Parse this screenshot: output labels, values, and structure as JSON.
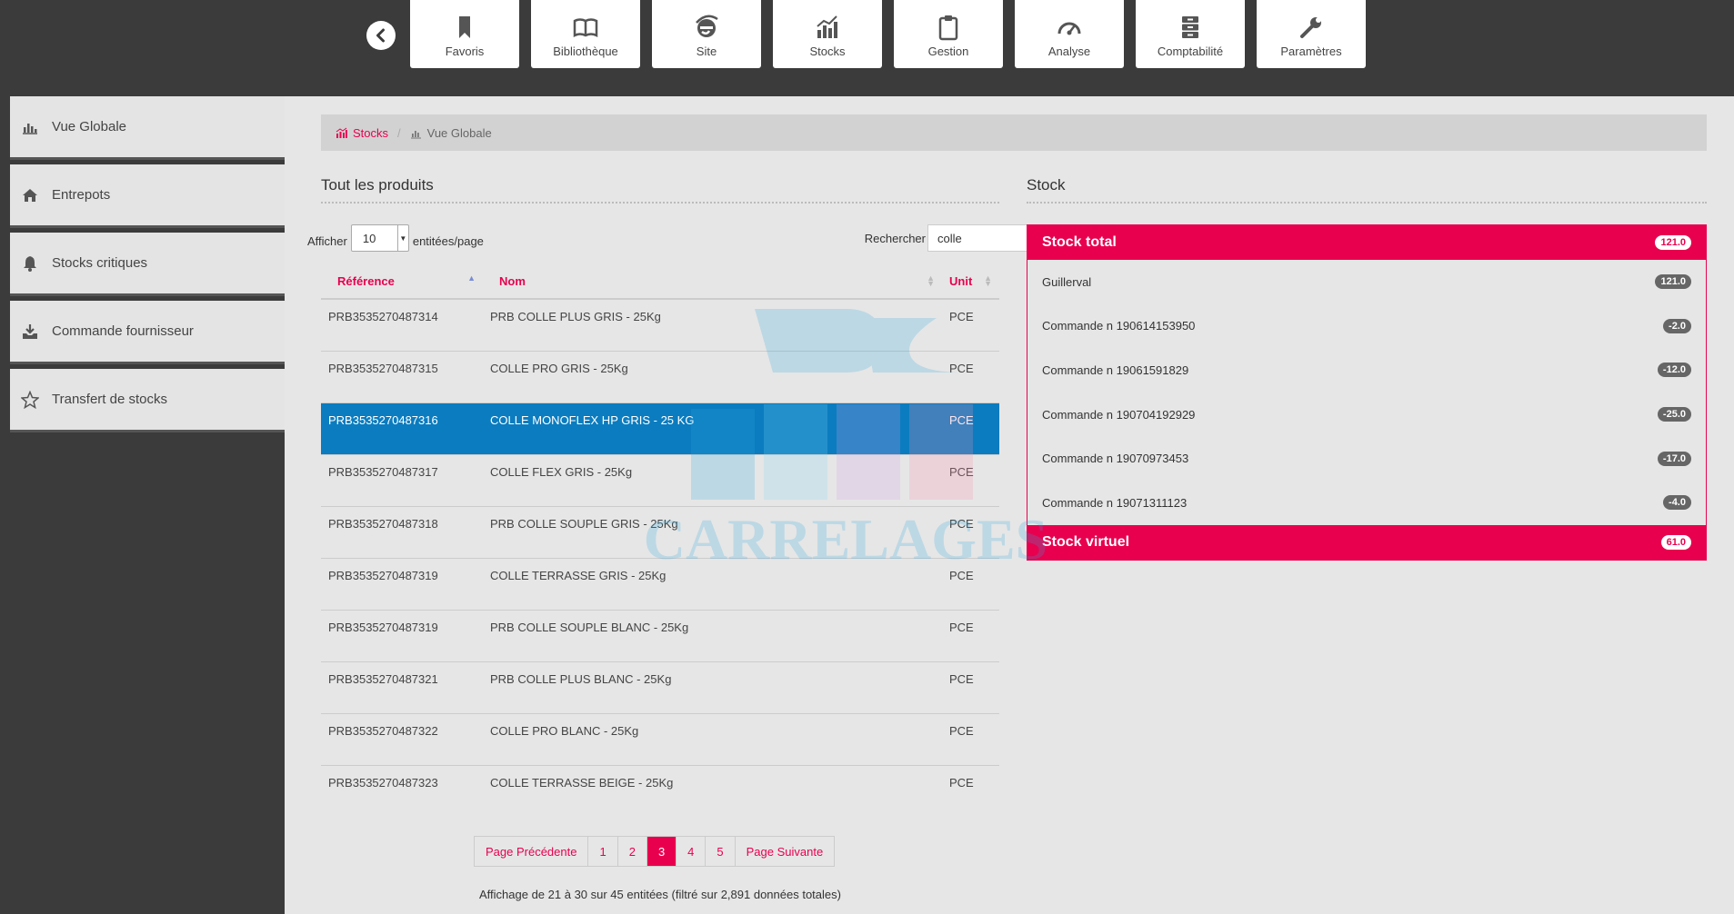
{
  "toolbar": {
    "tiles": [
      {
        "label": "Favoris",
        "icon": "bookmark-icon"
      },
      {
        "label": "Bibliothèque",
        "icon": "book-icon"
      },
      {
        "label": "Site",
        "icon": "internet-explorer-icon"
      },
      {
        "label": "Stocks",
        "icon": "chart-icon"
      },
      {
        "label": "Gestion",
        "icon": "clipboard-icon"
      },
      {
        "label": "Analyse",
        "icon": "gauge-icon"
      },
      {
        "label": "Comptabilité",
        "icon": "archive-icon"
      },
      {
        "label": "Paramètres",
        "icon": "wrench-icon"
      }
    ]
  },
  "sidebar": {
    "items": [
      {
        "label": "Vue Globale",
        "icon": "bar-chart-icon"
      },
      {
        "label": "Entrepots",
        "icon": "home-icon"
      },
      {
        "label": "Stocks critiques",
        "icon": "bell-icon"
      },
      {
        "label": "Commande fournisseur",
        "icon": "download-icon"
      },
      {
        "label": "Transfert de stocks",
        "icon": "star-icon"
      }
    ]
  },
  "breadcrumb": {
    "root": "Stocks",
    "current": "Vue Globale"
  },
  "products": {
    "title": "Tout les produits",
    "show_label": "Afficher",
    "page_size": "10",
    "per_page_label": "entitées/page",
    "search_label": "Rechercher",
    "search_value": "colle",
    "columns": [
      "Référence",
      "Nom",
      "Unit"
    ],
    "rows": [
      {
        "ref": "PRB3535270487314",
        "name": "PRB COLLE PLUS GRIS - 25Kg",
        "unit": "PCE"
      },
      {
        "ref": "PRB3535270487315",
        "name": "COLLE PRO GRIS - 25Kg",
        "unit": "PCE"
      },
      {
        "ref": "PRB3535270487316",
        "name": "COLLE MONOFLEX HP GRIS - 25 KG",
        "unit": "PCE"
      },
      {
        "ref": "PRB3535270487317",
        "name": "COLLE FLEX GRIS - 25Kg",
        "unit": "PCE"
      },
      {
        "ref": "PRB3535270487318",
        "name": "PRB COLLE SOUPLE GRIS - 25Kg",
        "unit": "PCE"
      },
      {
        "ref": "PRB3535270487319",
        "name": "COLLE TERRASSE GRIS - 25Kg",
        "unit": "PCE"
      },
      {
        "ref": "PRB3535270487319",
        "name": "PRB COLLE SOUPLE BLANC - 25Kg",
        "unit": "PCE"
      },
      {
        "ref": "PRB3535270487321",
        "name": "PRB COLLE PLUS BLANC - 25Kg",
        "unit": "PCE"
      },
      {
        "ref": "PRB3535270487322",
        "name": "COLLE PRO BLANC - 25Kg",
        "unit": "PCE"
      },
      {
        "ref": "PRB3535270487323",
        "name": "COLLE TERRASSE BEIGE - 25Kg",
        "unit": "PCE"
      }
    ],
    "selected_row": 2,
    "pagination": {
      "prev": "Page Précédente",
      "pages": [
        "1",
        "2",
        "3",
        "4",
        "5"
      ],
      "current": "3",
      "next": "Page Suivante"
    },
    "info": "Affichage de 21 à 30 sur 45 entitées (filtré sur 2,891 données totales)"
  },
  "stock": {
    "title": "Stock",
    "total_label": "Stock total",
    "total_value": "121.0",
    "lines": [
      {
        "label": "Guillerval",
        "value": "121.0"
      },
      {
        "label": "Commande n 190614153950",
        "value": "-2.0"
      },
      {
        "label": "Commande n 19061591829",
        "value": "-12.0"
      },
      {
        "label": "Commande n 190704192929",
        "value": "-25.0"
      },
      {
        "label": "Commande n 19070973453",
        "value": "-17.0"
      },
      {
        "label": "Commande n 19071311123",
        "value": "-4.0"
      }
    ],
    "virtual_label": "Stock virtuel",
    "virtual_value": "61.0"
  },
  "colors": {
    "accent": "#e8004f",
    "selected": "#0b7cbf",
    "background": "#3b3b3b",
    "panel": "#e6e6e6"
  },
  "watermark": {
    "text": "CARRELAGES"
  }
}
